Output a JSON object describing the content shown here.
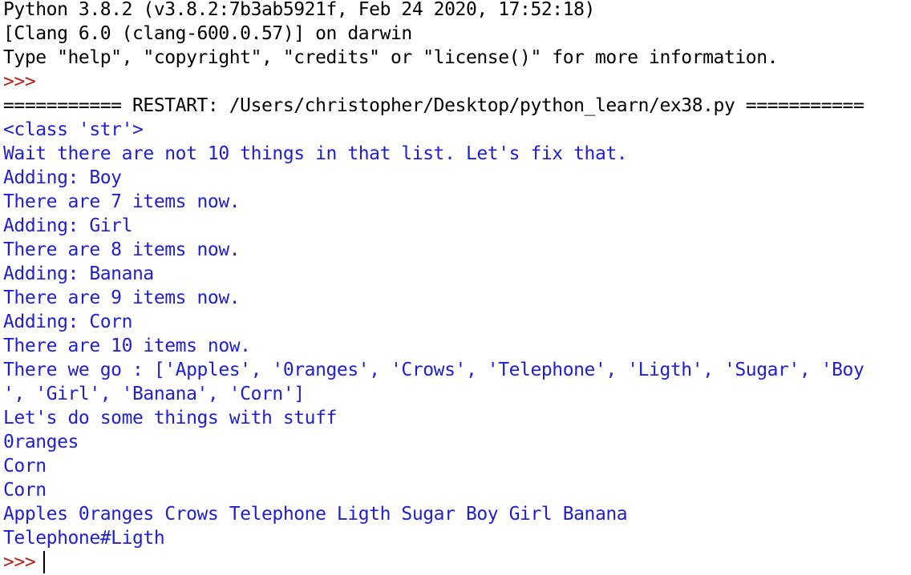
{
  "shell": {
    "banner": [
      "Python 3.8.2 (v3.8.2:7b3ab5921f, Feb 24 2020, 17:52:18)",
      "[Clang 6.0 (clang-600.0.57)] on darwin",
      "Type \"help\", \"copyright\", \"credits\" or \"license()\" for more information."
    ],
    "prompt": ">>>",
    "restart_line": "=========== RESTART: /Users/christopher/Desktop/python_learn/ex38.py ===========",
    "output": [
      "<class 'str'>",
      "Wait there are not 10 things in that list. Let's fix that.",
      "Adding: Boy",
      "There are 7 items now.",
      "Adding: Girl",
      "There are 8 items now.",
      "Adding: Banana",
      "There are 9 items now.",
      "Adding: Corn",
      "There are 10 items now.",
      "There we go : ['Apples', '0ranges', 'Crows', 'Telephone', 'Ligth', 'Sugar', 'Boy",
      "', 'Girl', 'Banana', 'Corn']",
      "Let's do some things with stuff",
      "0ranges",
      "Corn",
      "Corn",
      "Apples 0ranges Crows Telephone Ligth Sugar Boy Girl Banana",
      "Telephone#Ligth"
    ]
  },
  "colors": {
    "system_text": "#000000",
    "program_output": "#1f1fcf",
    "prompt": "#b3201c"
  }
}
